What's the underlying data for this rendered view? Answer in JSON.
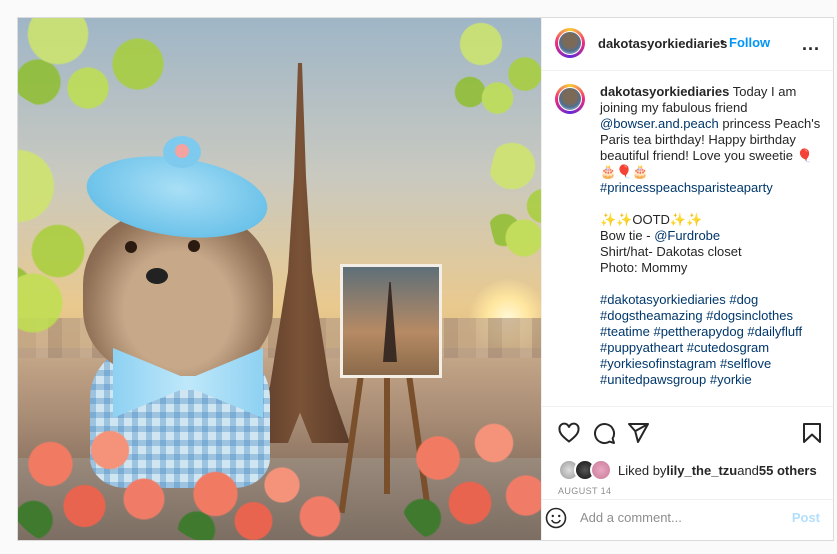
{
  "post": {
    "username": "dakotasyorkiediaries",
    "follow_label": "Follow",
    "separator": "•",
    "more_label": "...",
    "caption": {
      "line1_text": " Today I am joining my fabulous friend ",
      "mention1": "@bowser.and.peach",
      "line2_text": " princess Peach's Paris tea birthday! Happy birthday beautiful friend! Love you sweetie 🎈🎂🎈🎂",
      "hashtag1": "#princesspeachsparisteaparty",
      "ootd": "✨✨OOTD✨✨",
      "bowtie_prefix": "Bow tie - ",
      "mention2": "@Furdrobe",
      "shirt_line": "Shirt/hat- Dakotas closet",
      "photo_line": "Photo: Mommy",
      "hashtags": "#dakotasyorkiediaries #dog #dogstheamazing #dogsinclothes #teatime #pettherapydog #dailyfluff #puppyatheart #cutedosgram #yorkiesofinstagram #selflove #unitedpawsgroup #yorkie"
    },
    "likes": {
      "prefix": "Liked by ",
      "user": "lily_the_tzu",
      "middle": " and ",
      "others": "55 others"
    },
    "date": "AUGUST 14",
    "comment_placeholder": "Add a comment...",
    "post_label": "Post"
  },
  "icons": {
    "like": "heart-icon",
    "comment": "comment-icon",
    "share": "send-icon",
    "save": "bookmark-icon",
    "emoji": "emoji-icon",
    "more": "more-icon"
  },
  "colors": {
    "link": "#00376b",
    "follow": "#0095f6",
    "post_disabled": "#b2dffc",
    "muted": "#8e8e8e"
  }
}
